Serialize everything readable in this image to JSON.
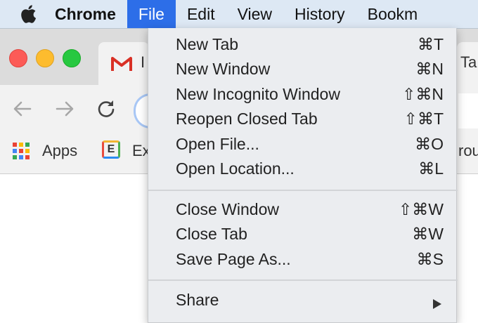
{
  "menubar": {
    "items": [
      "Chrome",
      "File",
      "Edit",
      "View",
      "History",
      "Bookm"
    ],
    "active": "File"
  },
  "browser": {
    "tabs": [
      "I",
      "Ta"
    ],
    "bookmarks": [
      "Apps",
      "Ex",
      "rou"
    ]
  },
  "file_menu": {
    "items": [
      {
        "label": "New Tab",
        "shortcut": "⌘T"
      },
      {
        "label": "New Window",
        "shortcut": "⌘N"
      },
      {
        "label": "New Incognito Window",
        "shortcut": "⇧⌘N"
      },
      {
        "label": "Reopen Closed Tab",
        "shortcut": "⇧⌘T"
      },
      {
        "label": "Open File...",
        "shortcut": "⌘O"
      },
      {
        "label": "Open Location...",
        "shortcut": "⌘L"
      },
      {
        "label": "Close Window",
        "shortcut": "⇧⌘W"
      },
      {
        "label": "Close Tab",
        "shortcut": "⌘W"
      },
      {
        "label": "Save Page As...",
        "shortcut": "⌘S"
      },
      {
        "label": "Share",
        "shortcut": ""
      }
    ]
  },
  "colors": {
    "menubar_bg": "#dde8f4",
    "active_highlight": "#2d6ee8",
    "menu_bg": "#ebedf0"
  }
}
